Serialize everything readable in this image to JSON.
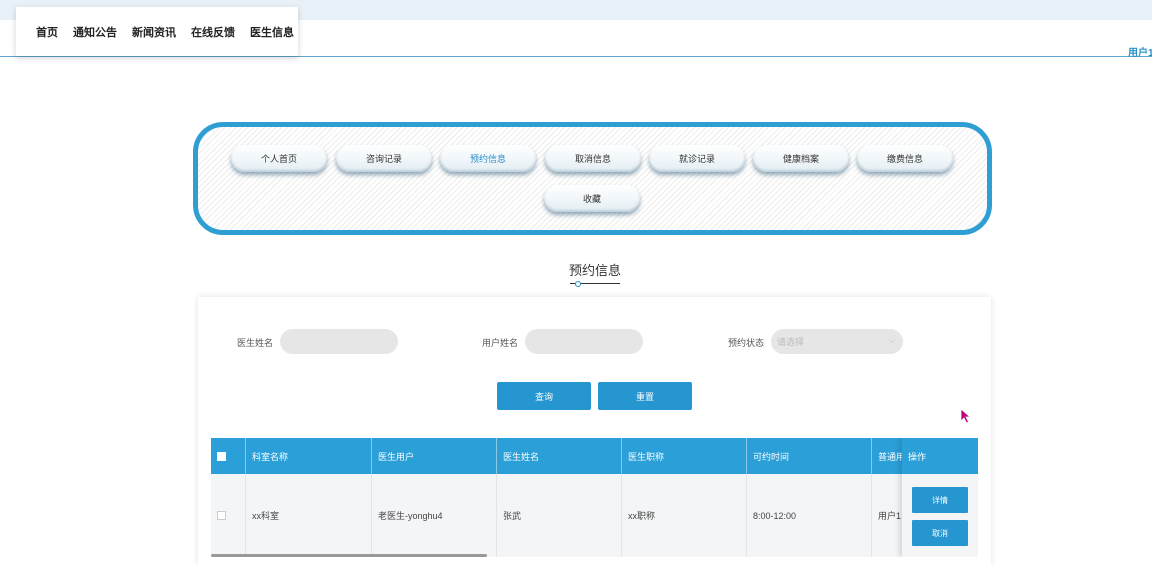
{
  "nav": {
    "items": [
      "首页",
      "通知公告",
      "新闻资讯",
      "在线反馈",
      "医生信息"
    ],
    "user_label": "用户1"
  },
  "menu": {
    "items": [
      "个人首页",
      "咨询记录",
      "预约信息",
      "取消信息",
      "就诊记录",
      "健康档案",
      "缴费信息",
      "收藏"
    ],
    "active": "预约信息"
  },
  "section": {
    "title": "预约信息"
  },
  "filters": {
    "doctor_name_label": "医生姓名",
    "user_name_label": "用户姓名",
    "status_label": "预约状态",
    "status_placeholder": "请选择",
    "search_button": "查询",
    "reset_button": "重置"
  },
  "table": {
    "columns": [
      "科室名称",
      "医生用户",
      "医生姓名",
      "医生职称",
      "可约时间",
      "普通用户",
      "操作"
    ],
    "rows": [
      {
        "dept": "xx科室",
        "doctor_user": "老医生-yonghu4",
        "doctor_name": "张武",
        "title": "xx职称",
        "time": "8:00-12:00",
        "user": "用户1"
      }
    ],
    "actions": {
      "detail": "详情",
      "cancel": "取消"
    }
  },
  "colors": {
    "accent": "#2596cf",
    "header_blue": "#2b9fd8"
  }
}
